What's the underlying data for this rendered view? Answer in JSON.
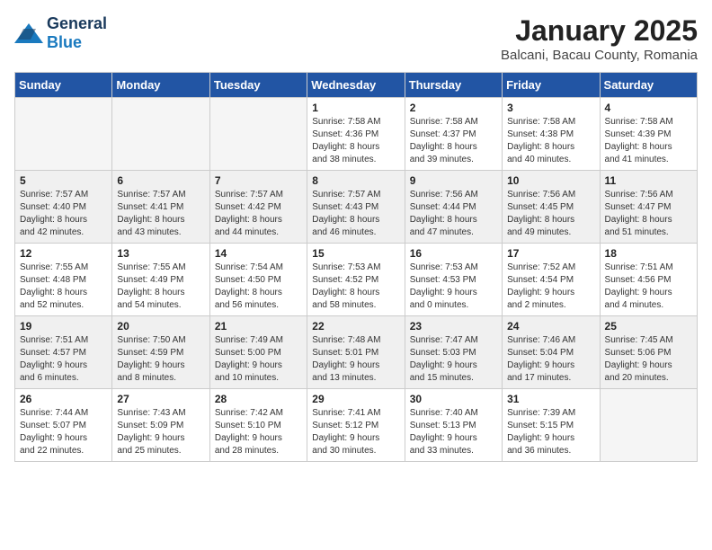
{
  "header": {
    "logo_general": "General",
    "logo_blue": "Blue",
    "title": "January 2025",
    "subtitle": "Balcani, Bacau County, Romania"
  },
  "days_of_week": [
    "Sunday",
    "Monday",
    "Tuesday",
    "Wednesday",
    "Thursday",
    "Friday",
    "Saturday"
  ],
  "weeks": [
    {
      "shaded": false,
      "days": [
        {
          "num": "",
          "info": ""
        },
        {
          "num": "",
          "info": ""
        },
        {
          "num": "",
          "info": ""
        },
        {
          "num": "1",
          "info": "Sunrise: 7:58 AM\nSunset: 4:36 PM\nDaylight: 8 hours\nand 38 minutes."
        },
        {
          "num": "2",
          "info": "Sunrise: 7:58 AM\nSunset: 4:37 PM\nDaylight: 8 hours\nand 39 minutes."
        },
        {
          "num": "3",
          "info": "Sunrise: 7:58 AM\nSunset: 4:38 PM\nDaylight: 8 hours\nand 40 minutes."
        },
        {
          "num": "4",
          "info": "Sunrise: 7:58 AM\nSunset: 4:39 PM\nDaylight: 8 hours\nand 41 minutes."
        }
      ]
    },
    {
      "shaded": true,
      "days": [
        {
          "num": "5",
          "info": "Sunrise: 7:57 AM\nSunset: 4:40 PM\nDaylight: 8 hours\nand 42 minutes."
        },
        {
          "num": "6",
          "info": "Sunrise: 7:57 AM\nSunset: 4:41 PM\nDaylight: 8 hours\nand 43 minutes."
        },
        {
          "num": "7",
          "info": "Sunrise: 7:57 AM\nSunset: 4:42 PM\nDaylight: 8 hours\nand 44 minutes."
        },
        {
          "num": "8",
          "info": "Sunrise: 7:57 AM\nSunset: 4:43 PM\nDaylight: 8 hours\nand 46 minutes."
        },
        {
          "num": "9",
          "info": "Sunrise: 7:56 AM\nSunset: 4:44 PM\nDaylight: 8 hours\nand 47 minutes."
        },
        {
          "num": "10",
          "info": "Sunrise: 7:56 AM\nSunset: 4:45 PM\nDaylight: 8 hours\nand 49 minutes."
        },
        {
          "num": "11",
          "info": "Sunrise: 7:56 AM\nSunset: 4:47 PM\nDaylight: 8 hours\nand 51 minutes."
        }
      ]
    },
    {
      "shaded": false,
      "days": [
        {
          "num": "12",
          "info": "Sunrise: 7:55 AM\nSunset: 4:48 PM\nDaylight: 8 hours\nand 52 minutes."
        },
        {
          "num": "13",
          "info": "Sunrise: 7:55 AM\nSunset: 4:49 PM\nDaylight: 8 hours\nand 54 minutes."
        },
        {
          "num": "14",
          "info": "Sunrise: 7:54 AM\nSunset: 4:50 PM\nDaylight: 8 hours\nand 56 minutes."
        },
        {
          "num": "15",
          "info": "Sunrise: 7:53 AM\nSunset: 4:52 PM\nDaylight: 8 hours\nand 58 minutes."
        },
        {
          "num": "16",
          "info": "Sunrise: 7:53 AM\nSunset: 4:53 PM\nDaylight: 9 hours\nand 0 minutes."
        },
        {
          "num": "17",
          "info": "Sunrise: 7:52 AM\nSunset: 4:54 PM\nDaylight: 9 hours\nand 2 minutes."
        },
        {
          "num": "18",
          "info": "Sunrise: 7:51 AM\nSunset: 4:56 PM\nDaylight: 9 hours\nand 4 minutes."
        }
      ]
    },
    {
      "shaded": true,
      "days": [
        {
          "num": "19",
          "info": "Sunrise: 7:51 AM\nSunset: 4:57 PM\nDaylight: 9 hours\nand 6 minutes."
        },
        {
          "num": "20",
          "info": "Sunrise: 7:50 AM\nSunset: 4:59 PM\nDaylight: 9 hours\nand 8 minutes."
        },
        {
          "num": "21",
          "info": "Sunrise: 7:49 AM\nSunset: 5:00 PM\nDaylight: 9 hours\nand 10 minutes."
        },
        {
          "num": "22",
          "info": "Sunrise: 7:48 AM\nSunset: 5:01 PM\nDaylight: 9 hours\nand 13 minutes."
        },
        {
          "num": "23",
          "info": "Sunrise: 7:47 AM\nSunset: 5:03 PM\nDaylight: 9 hours\nand 15 minutes."
        },
        {
          "num": "24",
          "info": "Sunrise: 7:46 AM\nSunset: 5:04 PM\nDaylight: 9 hours\nand 17 minutes."
        },
        {
          "num": "25",
          "info": "Sunrise: 7:45 AM\nSunset: 5:06 PM\nDaylight: 9 hours\nand 20 minutes."
        }
      ]
    },
    {
      "shaded": false,
      "days": [
        {
          "num": "26",
          "info": "Sunrise: 7:44 AM\nSunset: 5:07 PM\nDaylight: 9 hours\nand 22 minutes."
        },
        {
          "num": "27",
          "info": "Sunrise: 7:43 AM\nSunset: 5:09 PM\nDaylight: 9 hours\nand 25 minutes."
        },
        {
          "num": "28",
          "info": "Sunrise: 7:42 AM\nSunset: 5:10 PM\nDaylight: 9 hours\nand 28 minutes."
        },
        {
          "num": "29",
          "info": "Sunrise: 7:41 AM\nSunset: 5:12 PM\nDaylight: 9 hours\nand 30 minutes."
        },
        {
          "num": "30",
          "info": "Sunrise: 7:40 AM\nSunset: 5:13 PM\nDaylight: 9 hours\nand 33 minutes."
        },
        {
          "num": "31",
          "info": "Sunrise: 7:39 AM\nSunset: 5:15 PM\nDaylight: 9 hours\nand 36 minutes."
        },
        {
          "num": "",
          "info": ""
        }
      ]
    }
  ]
}
